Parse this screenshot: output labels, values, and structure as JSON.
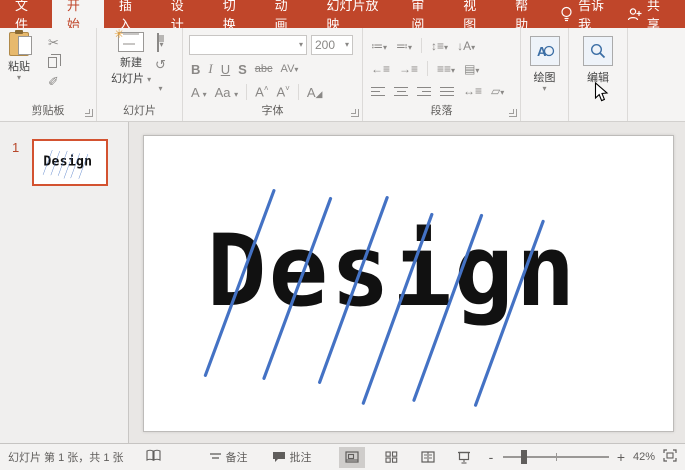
{
  "tabs": {
    "items": [
      {
        "label": "文件"
      },
      {
        "label": "开始"
      },
      {
        "label": "插入"
      },
      {
        "label": "设计"
      },
      {
        "label": "切换"
      },
      {
        "label": "动画"
      },
      {
        "label": "幻灯片放映"
      },
      {
        "label": "审阅"
      },
      {
        "label": "视图"
      },
      {
        "label": "帮助"
      }
    ],
    "tell_me": "告诉我",
    "share": "共享"
  },
  "ribbon": {
    "clipboard": {
      "paste_label": "粘贴",
      "group_label": "剪贴板"
    },
    "slides": {
      "new_line1": "新建",
      "new_line2": "幻灯片",
      "group_label": "幻灯片"
    },
    "font": {
      "font_size_value": "200",
      "bold": "B",
      "italic": "I",
      "underline": "U",
      "shadow": "S",
      "strikethrough": "abc",
      "char_spacing": "AV",
      "font_color": "A",
      "change_case": "Aa",
      "grow_font": "A",
      "shrink_font": "A",
      "clear_format": "A",
      "group_label": "字体"
    },
    "paragraph": {
      "group_label": "段落"
    },
    "drawing": {
      "label": "绘图"
    },
    "editing": {
      "label": "编辑"
    }
  },
  "slide_panel": {
    "slide_number": "1"
  },
  "slide": {
    "text": "Design",
    "line_color": "#4472c4",
    "lines": [
      [
        130,
        55,
        61,
        241
      ],
      [
        187,
        63,
        120,
        244
      ],
      [
        244,
        62,
        176,
        248
      ],
      [
        289,
        79,
        220,
        269
      ],
      [
        339,
        80,
        271,
        266
      ],
      [
        401,
        86,
        333,
        271
      ]
    ]
  },
  "status": {
    "slide_counter": "幻灯片 第 1 张，共 1 张",
    "notes_label": "备注",
    "comments_label": "批注",
    "zoom_minus": "-",
    "zoom_plus": "+",
    "zoom_value": "42%"
  },
  "colors": {
    "accent_red": "#c0462a",
    "thumb_border": "#d35230",
    "line_blue": "#4472c4"
  }
}
